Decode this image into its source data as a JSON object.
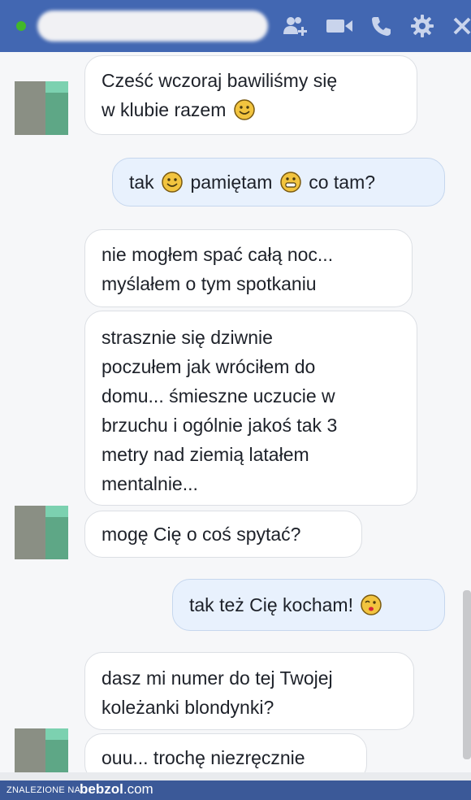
{
  "header": {
    "status_color": "#42b72a",
    "icons": [
      "add-person-icon",
      "video-camera-icon",
      "phone-icon",
      "gear-icon",
      "close-icon"
    ]
  },
  "messages": [
    {
      "from": "them",
      "parts": [
        "Cześć wczoraj bawiliśmy się",
        "w klubie razem"
      ],
      "emoji": "smile"
    },
    {
      "from": "me",
      "parts": [
        "tak",
        "pamiętam",
        "co tam?"
      ],
      "emoji": "smile"
    },
    {
      "from": "them",
      "parts": [
        "nie mogłem spać całą noc...",
        "myślałem o tym spotkaniu"
      ]
    },
    {
      "from": "them",
      "parts": [
        "strasznie się dziwnie",
        "poczułem jak wróciłem do",
        "domu... śmieszne uczucie w",
        "brzuchu i ogólnie jakoś tak 3",
        "metry nad ziemią latałem",
        "mentalnie..."
      ]
    },
    {
      "from": "them",
      "parts": [
        "mogę Cię o coś spytać?"
      ]
    },
    {
      "from": "me",
      "parts": [
        "tak też Cię kocham!"
      ],
      "emoji": "kiss"
    },
    {
      "from": "them",
      "parts": [
        "dasz mi numer do tej Twojej",
        "koleżanki blondynki?"
      ]
    },
    {
      "from": "them",
      "parts": [
        "ouu... trochę niezręcznie"
      ]
    }
  ],
  "footer": {
    "label": "ZNALEZIONE NA",
    "site_name": "bebzol",
    "site_tld": ".com"
  }
}
